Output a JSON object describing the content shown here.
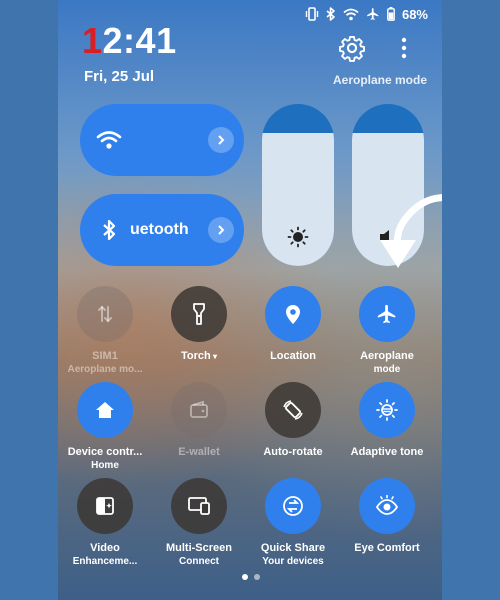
{
  "status": {
    "battery": "68%"
  },
  "header": {
    "clock_first": "1",
    "clock_rest": "2:41",
    "date": "Fri, 25 Jul",
    "mode_label": "Aeroplane mode"
  },
  "connectivity": {
    "wifi_label": "",
    "bluetooth_label": "uetooth"
  },
  "sliders": {
    "brightness_level": 0.82,
    "volume_level": 0.82
  },
  "tiles": [
    {
      "line1": "SIM1",
      "line2": "Aeroplane mo...",
      "icon": "data-arrows-icon",
      "state": "disabled"
    },
    {
      "line1": "Torch",
      "line2": "",
      "icon": "torch-icon",
      "state": "off"
    },
    {
      "line1": "Location",
      "line2": "",
      "icon": "location-icon",
      "state": "on"
    },
    {
      "line1": "Aeroplane",
      "line2": "mode",
      "icon": "airplane-icon",
      "state": "on"
    },
    {
      "line1": "Device contr...",
      "line2": "Home",
      "icon": "home-icon",
      "state": "on"
    },
    {
      "line1": "E-wallet",
      "line2": "",
      "icon": "wallet-icon",
      "state": "disabled"
    },
    {
      "line1": "Auto-rotate",
      "line2": "",
      "icon": "auto-rotate-icon",
      "state": "off"
    },
    {
      "line1": "Adaptive tone",
      "line2": "",
      "icon": "adaptive-tone-icon",
      "state": "on"
    },
    {
      "line1": "Video",
      "line2": "Enhanceme...",
      "icon": "video-enhance-icon",
      "state": "off"
    },
    {
      "line1": "Multi-Screen",
      "line2": "Connect",
      "icon": "multi-screen-icon",
      "state": "off"
    },
    {
      "line1": "Quick Share",
      "line2": "Your devices",
      "icon": "quick-share-icon",
      "state": "on"
    },
    {
      "line1": "Eye Comfort",
      "line2": "",
      "icon": "eye-comfort-icon",
      "state": "on"
    }
  ],
  "colors": {
    "accent": "#2f80ed",
    "clock_red": "#d81f26"
  }
}
